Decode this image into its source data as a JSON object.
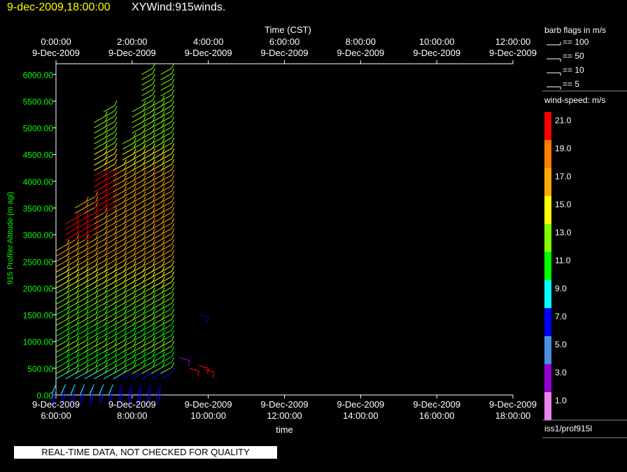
{
  "header": {
    "date_time": "9-dec-2009,18:00:00",
    "plot_name": "XYWind:915winds."
  },
  "colors": {
    "background": "#000000",
    "axis": "#ffffff",
    "y_axis_text": "#00ff00",
    "date_text": "#ffff00"
  },
  "chart_data": {
    "type": "wind-barb time-height",
    "top_axis": {
      "label": "Time (CST)",
      "ticks": [
        {
          "time": "0:00:00",
          "date": "9-Dec-2009"
        },
        {
          "time": "2:00:00",
          "date": "9-Dec-2009"
        },
        {
          "time": "4:00:00",
          "date": "9-Dec-2009"
        },
        {
          "time": "6:00:00",
          "date": "9-Dec-2009"
        },
        {
          "time": "8:00:00",
          "date": "9-Dec-2009"
        },
        {
          "time": "10:00:00",
          "date": "9-Dec-2009"
        },
        {
          "time": "12:00:00",
          "date": "9-Dec-2009"
        }
      ]
    },
    "bottom_axis": {
      "label": "time",
      "ticks": [
        {
          "date": "9-Dec-2009",
          "time": "6:00:00"
        },
        {
          "date": "9-Dec-2009",
          "time": "8:00:00"
        },
        {
          "date": "9-Dec-2009",
          "time": "10:00:00"
        },
        {
          "date": "9-Dec-2009",
          "time": "12:00:00"
        },
        {
          "date": "9-Dec-2009",
          "time": "14:00:00"
        },
        {
          "date": "9-Dec-2009",
          "time": "16:00:00"
        },
        {
          "date": "9-Dec-2009",
          "time": "18:00:00"
        }
      ],
      "range_hours_utc": [
        6,
        18
      ]
    },
    "y_axis": {
      "label": "915 Profiler Altitude (m agl)",
      "range": [
        0,
        6200
      ],
      "tick_values": [
        0,
        500,
        1000,
        1500,
        2000,
        2500,
        3000,
        3500,
        4000,
        4500,
        5000,
        5500,
        6000
      ],
      "tick_labels": [
        "0.00",
        "500.00",
        "1000.00",
        "1500.00",
        "2000.00",
        "2500.00",
        "3000.00",
        "3500.00",
        "4000.00",
        "4500.00",
        "5000.00",
        "5500.00",
        "6000.00"
      ]
    },
    "profiles": [
      {
        "time_utc": 6.0,
        "min_alt": 0,
        "max_alt": 2750
      },
      {
        "time_utc": 6.25,
        "min_alt": 0,
        "max_alt": 3200
      },
      {
        "time_utc": 6.5,
        "min_alt": 0,
        "max_alt": 3550
      },
      {
        "time_utc": 6.75,
        "min_alt": 0,
        "max_alt": 3650
      },
      {
        "time_utc": 7.0,
        "min_alt": 0,
        "max_alt": 5100
      },
      {
        "time_utc": 7.25,
        "min_alt": 0,
        "max_alt": 5350
      },
      {
        "time_utc": 7.5,
        "min_alt": 0,
        "max_alt": 4250
      },
      {
        "time_utc": 7.75,
        "min_alt": 0,
        "max_alt": 4750
      },
      {
        "time_utc": 8.0,
        "min_alt": 0,
        "max_alt": 5300
      },
      {
        "time_utc": 8.25,
        "min_alt": 0,
        "max_alt": 6000
      },
      {
        "time_utc": 8.5,
        "min_alt": 0,
        "max_alt": 5400
      },
      {
        "time_utc": 8.75,
        "min_alt": 0,
        "max_alt": 6000
      }
    ],
    "isolated_barbs": [
      {
        "time_utc": 9.75,
        "alt": 1500,
        "speed": 7
      },
      {
        "time_utc": 9.5,
        "alt": 500,
        "speed": 21
      },
      {
        "time_utc": 9.75,
        "alt": 550,
        "speed": 21
      },
      {
        "time_utc": 9.9,
        "alt": 480,
        "speed": 21
      },
      {
        "time_utc": 9.25,
        "alt": 700,
        "speed": 3
      }
    ]
  },
  "legend": {
    "barb_title": "barb flags in m/s",
    "barb_items": [
      {
        "label": "== 100"
      },
      {
        "label": "== 50"
      },
      {
        "label": "== 10"
      },
      {
        "label": "== 5"
      }
    ],
    "speed_title": "wind-speed: m/s",
    "speed_scale": [
      {
        "label": "21.0",
        "color": "#ff0000"
      },
      {
        "label": "19.0",
        "color": "#ff7f00"
      },
      {
        "label": "17.0",
        "color": "#ffaa00"
      },
      {
        "label": "15.0",
        "color": "#ffff00"
      },
      {
        "label": "13.0",
        "color": "#7fff00"
      },
      {
        "label": "11.0",
        "color": "#00ff00"
      },
      {
        "label": "9.0",
        "color": "#00ffff"
      },
      {
        "label": "7.0",
        "color": "#0000ff"
      },
      {
        "label": "5.0",
        "color": "#4a90e2"
      },
      {
        "label": "3.0",
        "color": "#9400d3"
      },
      {
        "label": "1.0",
        "color": "#ee82ee"
      }
    ],
    "source": "iss1/prof915l"
  },
  "footer": {
    "qc_notice": "REAL-TIME DATA, NOT CHECKED FOR QUALITY"
  }
}
